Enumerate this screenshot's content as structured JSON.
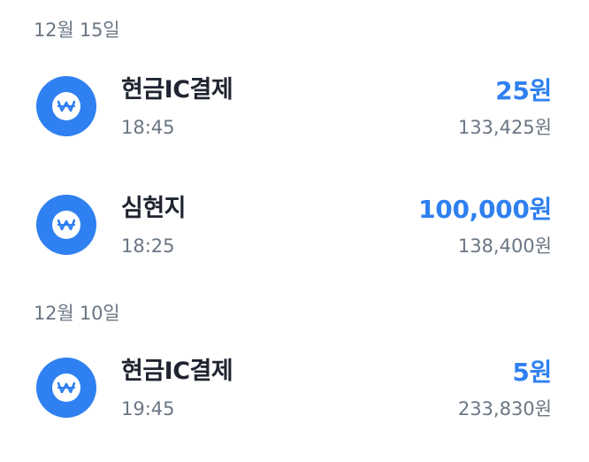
{
  "colors": {
    "accent": "#2f80f0",
    "title": "#1f2430",
    "secondary": "#6b7684",
    "background": "#ffffff"
  },
  "groups": [
    {
      "date": "12월 15일",
      "transactions": [
        {
          "icon": "won-icon",
          "title": "현금IC결제",
          "time": "18:45",
          "amount": "25원",
          "balance": "133,425원"
        },
        {
          "icon": "won-icon",
          "title": "심현지",
          "time": "18:25",
          "amount": "100,000원",
          "balance": "138,400원"
        }
      ]
    },
    {
      "date": "12월 10일",
      "transactions": [
        {
          "icon": "won-icon",
          "title": "현금IC결제",
          "time": "19:45",
          "amount": "5원",
          "balance": "233,830원"
        }
      ]
    }
  ]
}
